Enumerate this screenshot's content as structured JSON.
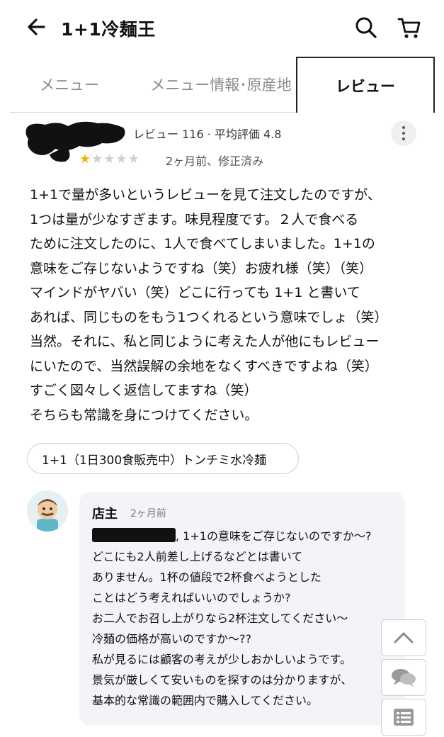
{
  "header": {
    "title": "1+1冷麺王",
    "back_icon": "arrow-left-icon",
    "search_icon": "search-icon",
    "cart_icon": "cart-icon"
  },
  "tabs": [
    {
      "label": "メニュー",
      "active": false
    },
    {
      "label": "メニュー情報･原産地",
      "active": false
    },
    {
      "label": "レビュー",
      "active": true
    }
  ],
  "review": {
    "reviewer_meta": "レビュー 116 · 平均評価 4.8",
    "rating": 1,
    "rating_max": 5,
    "date": "2ヶ月前、修正済み",
    "body_lines": [
      "1+1で量が多いというレビューを見て注文したのですが、",
      "1つは量が少なすぎます。味見程度です。２人で食べる",
      "ために注文したのに、1人で食べてしまいました。1+1の",
      "意味をご存じないようですね（笑）お疲れ様（笑）（笑）",
      "マインドがヤバい（笑）どこに行っても 1+1 と書いて",
      "あれば、同じものをもう1つくれるという意味でしょ（笑）",
      "当然。それに、私と同じように考えた人が他にもレビュー",
      "にいたので、当然誤解の余地をなくすべきですよね（笑）",
      "すごく図々しく返信してますね（笑）",
      "そちらも常識を身につけてください。"
    ],
    "menu_chip": "1+1（1日300食販売中）トンチミ水冷麺"
  },
  "owner_reply": {
    "name": "店主",
    "time": "2ヶ月前",
    "first_line_suffix": ", 1+1の意味をご存じないのですか～?",
    "body_lines": [
      "どこにも2人前差し上げるなどとは書いて",
      "ありません。1杯の値段で2杯食べようとした",
      "ことはどう考えればいいのでしょうか?",
      "お二人でお召し上がりなら2杯注文してください～",
      "冷麺の価格が高いのですか～??",
      "私が見るには顧客の考えが少しおかしいようです。",
      "景気が厳しくて安いものを探すのは分かりますが、",
      "基本的な常識の範囲内で購入してください。"
    ]
  },
  "floating": {
    "top_icon": "chevron-up-icon",
    "chat_icon": "chat-bubbles-icon",
    "list_icon": "list-icon"
  },
  "colors": {
    "star_on": "#f4b400",
    "star_off": "#cfcfcf",
    "reply_bg": "#f3f4f8"
  }
}
